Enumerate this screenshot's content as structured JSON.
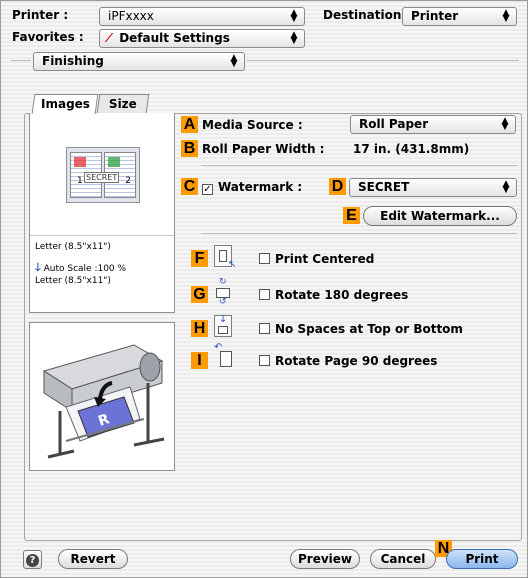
{
  "header": {
    "printer_label": "Printer :",
    "printer_value": "iPFxxxx",
    "destination_label": "Destination :",
    "destination_value": "Printer",
    "favorites_label": "Favorites :",
    "favorites_value": "Default Settings"
  },
  "panel_select": "Finishing",
  "tabs": [
    {
      "label": "Images",
      "selected": true
    },
    {
      "label": "Size",
      "selected": false
    }
  ],
  "preview": {
    "sheet_left_number": "1",
    "watermark_text": "SECRET",
    "sheet_right_number": "2",
    "paper_from": "Letter (8.5\"x11\")",
    "auto_scale": "Auto Scale :100 %",
    "paper_to": "Letter (8.5\"x11\")"
  },
  "settings": {
    "media_source_label": "Media Source :",
    "media_source_value": "Roll Paper",
    "roll_width_label": "Roll Paper Width :",
    "roll_width_value": "17 in. (431.8mm)",
    "watermark_label": "Watermark :",
    "watermark_checked": true,
    "watermark_value": "SECRET",
    "edit_watermark_button": "Edit Watermark...",
    "print_centered": "Print Centered",
    "rotate_180": "Rotate 180 degrees",
    "no_spaces": "No Spaces at Top or Bottom",
    "rotate_90": "Rotate Page 90 degrees"
  },
  "callouts": {
    "a": "A",
    "b": "B",
    "c": "C",
    "d": "D",
    "e": "E",
    "f": "F",
    "g": "G",
    "h": "H",
    "i": "I",
    "n": "N"
  },
  "footer": {
    "help_icon_glyph": "?",
    "revert_button": "Revert",
    "preview_button": "Preview",
    "cancel_button": "Cancel",
    "print_button": "Print"
  },
  "colors": {
    "callout": "#ff9a00",
    "default_button": "#8bb6ec",
    "watermark_text": "#3a5fcd"
  }
}
